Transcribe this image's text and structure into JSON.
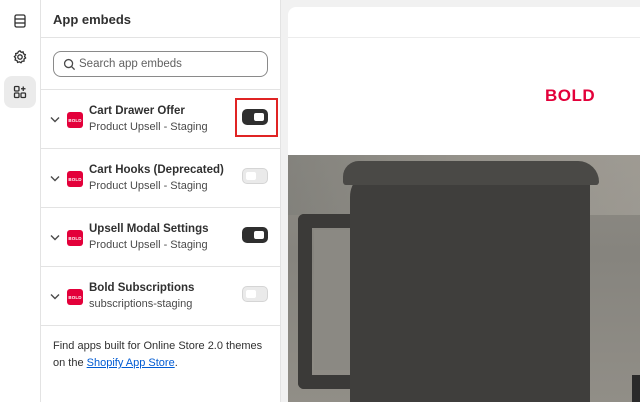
{
  "rail": {
    "items": [
      {
        "icon": "sections-icon"
      },
      {
        "icon": "gear-icon"
      },
      {
        "icon": "apps-icon",
        "active": true
      }
    ]
  },
  "panel": {
    "title": "App embeds",
    "search": {
      "placeholder": "Search app embeds",
      "value": ""
    },
    "embeds": [
      {
        "name": "Cart Drawer Offer",
        "app": "Product Upsell - Staging",
        "enabled": true,
        "highlighted": true
      },
      {
        "name": "Cart Hooks (Deprecated)",
        "app": "Product Upsell - Staging",
        "enabled": false
      },
      {
        "name": "Upsell Modal Settings",
        "app": "Product Upsell - Staging",
        "enabled": true
      },
      {
        "name": "Bold Subscriptions",
        "app": "subscriptions-staging",
        "enabled": false
      }
    ],
    "logo_text": "BOLD",
    "footer": {
      "text_before": "Find apps built for Online Store 2.0 themes on the ",
      "link": "Shopify App Store",
      "text_after": "."
    }
  },
  "preview": {
    "brand_logo": "BOLD"
  },
  "colors": {
    "brand": "#e3003a",
    "toggle_on": "#2f2f2f",
    "highlight": "#e02424",
    "link": "#005bd3"
  }
}
